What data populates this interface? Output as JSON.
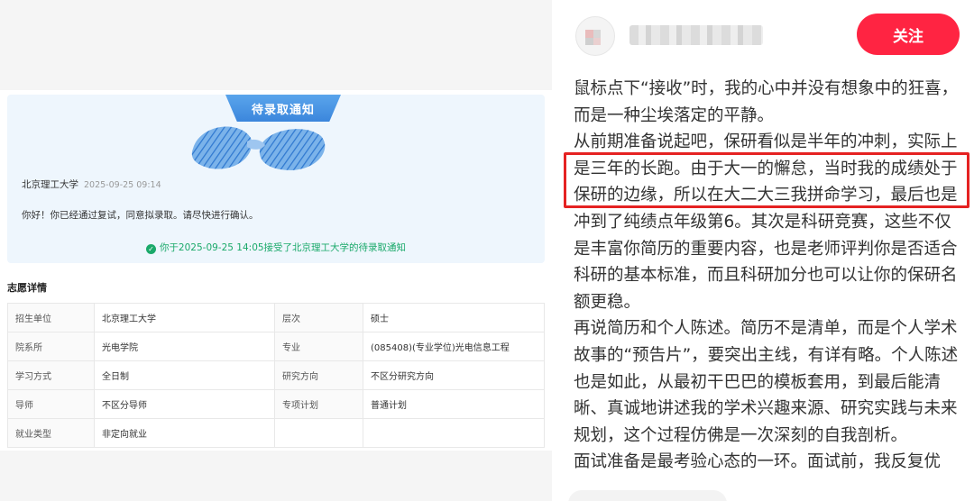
{
  "notice": {
    "banner": "待录取通知",
    "school": "北京理工大学",
    "time": "2025-09-25 09:14",
    "message": "你好！你已经通过复试，同意拟录取。请尽快进行确认。",
    "accepted": "你于2025-09-25 14:05接受了北京理工大学的待录取通知"
  },
  "details": {
    "title": "志愿详情",
    "rows": [
      [
        "招生单位",
        "北京理工大学",
        "层次",
        "硕士"
      ],
      [
        "院系所",
        "光电学院",
        "专业",
        "(085408)(专业学位)光电信息工程"
      ],
      [
        "学习方式",
        "全日制",
        "研究方向",
        "不区分研究方向"
      ],
      [
        "导师",
        "不区分导师",
        "专项计划",
        "普通计划"
      ],
      [
        "就业类型",
        "非定向就业",
        "",
        ""
      ]
    ]
  },
  "post": {
    "follow_label": "关注",
    "paragraphs": [
      "鼠标点下“接收”时，我的心中并没有想象中的狂喜，而是一种尘埃落定的平静。",
      "从前期准备说起吧，保研看似是半年的冲刺，实际上是三年的长跑。由于大一的懈怠，当时我的成绩处于保研的边缘，所以在大二大三我拼命学习，最后也是冲到了纯绩点年级第6。其次是科研竞赛，这些不仅是丰富你简历的重要内容，也是老师评判你是否适合科研的基本标准，而且科研加分也可以让你的保研名额更稳。",
      "再说简历和个人陈述。简历不是清单，而是个人学术故事的“预告片”，要突出主线，有详有略。个人陈述也是如此，从最初干巴巴的模板套用，到最后能清晰、真诚地讲述我的学术兴趣来源、研究实践与未来规划，这个过程仿佛是一次深刻的自我剖析。",
      "面试准备是最考验心态的一环。面试前，我反复优"
    ]
  },
  "colors": {
    "accent": "#ff2442",
    "highlight": "#e52222",
    "notice_bg": "#eef6fd",
    "success": "#1aa96a"
  },
  "icons": {
    "accepted": "check-circle-icon",
    "stamp": "blue-seal-stamp-icon"
  }
}
